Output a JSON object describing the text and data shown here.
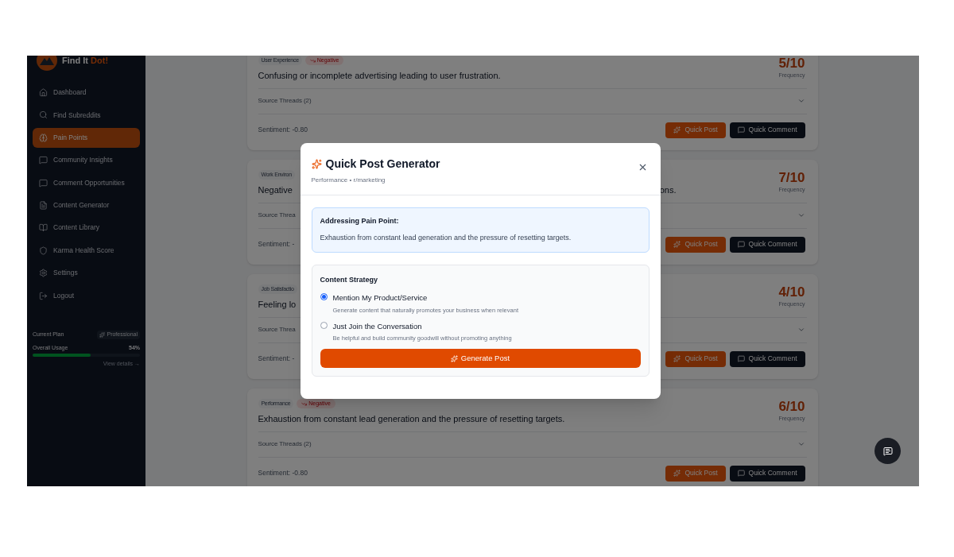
{
  "brand": {
    "name": "Find It",
    "accent": "Dot!"
  },
  "nav": [
    {
      "label": "Dashboard",
      "selected": false
    },
    {
      "label": "Find Subreddits",
      "selected": false
    },
    {
      "label": "Pain Points",
      "selected": true
    },
    {
      "label": "Community Insights",
      "selected": false
    },
    {
      "label": "Comment Opportunities",
      "selected": false
    },
    {
      "label": "Content Generator",
      "selected": false
    },
    {
      "label": "Content Library",
      "selected": false
    },
    {
      "label": "Karma Health Score",
      "selected": false
    },
    {
      "label": "Settings",
      "selected": false
    },
    {
      "label": "Logout",
      "selected": false
    }
  ],
  "plan": {
    "label": "Current Plan",
    "name": "Professional",
    "usage_label": "Overall Usage",
    "usage_value": "54%",
    "level": 0.54,
    "link": "View details →"
  },
  "cards": [
    {
      "tags": [
        {
          "label": "User Experience",
          "kind": "category"
        },
        {
          "label": "Negative",
          "kind": "sentiment"
        }
      ],
      "title": "Confusing or incomplete advertising leading to user frustration.",
      "score": "5/10",
      "score_label": "Frequency",
      "threads": "Source Threads (2)",
      "sentiment": "Sentiment: -0.80",
      "actions": [
        {
          "label": "Quick Post",
          "kind": "post"
        },
        {
          "label": "Quick Comment",
          "kind": "comment"
        }
      ]
    },
    {
      "tags": [
        {
          "label": "Work Environ",
          "kind": "category"
        }
      ],
      "title": "Negative",
      "title_end": "ons.",
      "score": "7/10",
      "score_label": "Frequency",
      "threads": "Source Threa",
      "sentiment": "Sentiment: -",
      "actions": [
        {
          "label": "Quick Post",
          "kind": "post"
        },
        {
          "label": "Quick Comment",
          "kind": "comment"
        }
      ]
    },
    {
      "tags": [
        {
          "label": "Job Satisfactio",
          "kind": "category"
        }
      ],
      "title": "Feeling lo",
      "score": "4/10",
      "score_label": "Frequency",
      "threads": "Source Threa",
      "sentiment": "Sentiment: -",
      "actions": [
        {
          "label": "Quick Post",
          "kind": "post"
        },
        {
          "label": "Quick Comment",
          "kind": "comment"
        }
      ]
    },
    {
      "tags": [
        {
          "label": "Performance",
          "kind": "category"
        },
        {
          "label": "Negative",
          "kind": "sentiment"
        }
      ],
      "title": "Exhaustion from constant lead generation and the pressure of resetting targets.",
      "score": "6/10",
      "score_label": "Frequency",
      "threads": "Source Threads (2)",
      "sentiment": "Sentiment: -0.80",
      "actions": [
        {
          "label": "Quick Post",
          "kind": "post"
        },
        {
          "label": "Quick Comment",
          "kind": "comment"
        }
      ]
    }
  ],
  "modal": {
    "title": "Quick Post Generator",
    "subtitle": "Performance • r/marketing",
    "pain_heading": "Addressing Pain Point:",
    "pain_text": "Exhaustion from constant lead generation and the pressure of resetting targets.",
    "strategy_heading": "Content Strategy",
    "options": [
      {
        "label": "Mention My Product/Service",
        "description": "Generate content that naturally promotes your business when relevant",
        "selected": true
      },
      {
        "label": "Just Join the Conversation",
        "description": "Be helpful and build community goodwill without promoting anything",
        "selected": false
      }
    ],
    "button": "Generate Post"
  }
}
